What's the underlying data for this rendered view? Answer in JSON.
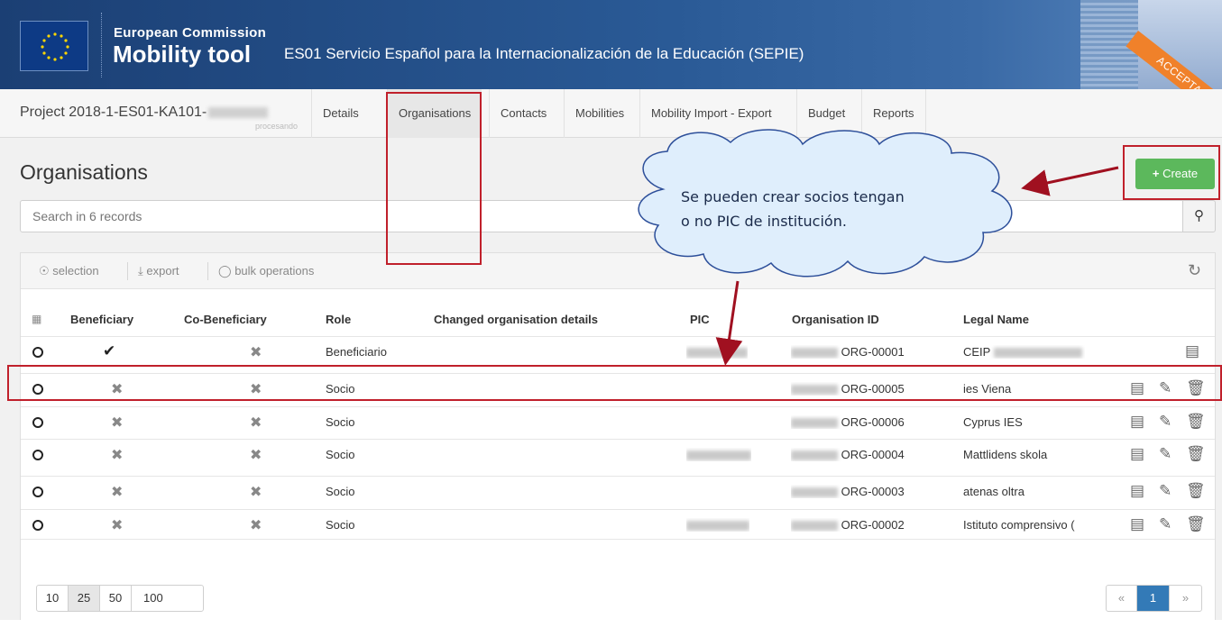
{
  "header": {
    "org_name": "European Commission",
    "app_name": "Mobility tool",
    "agency": "ES01 Servicio Español para la Internacionalización de la Educación (SEPIE)",
    "env_ribbon": "ACCEPTANCE"
  },
  "nav": {
    "project_label": "Project 2018-1-ES01-KA101-",
    "project_sub": "procesando",
    "tabs": [
      "Details",
      "Organisations",
      "Contacts",
      "Mobilities",
      "Mobility Import - Export",
      "Budget",
      "Reports"
    ],
    "active_tab": "Organisations"
  },
  "page": {
    "title": "Organisations",
    "create_label": "Create",
    "search_placeholder": "Search in 6 records"
  },
  "toolbar": {
    "selection_label": "selection",
    "export_label": "export",
    "bulk_label": "bulk operations"
  },
  "table": {
    "columns": [
      "Beneficiary",
      "Co-Beneficiary",
      "Role",
      "Changed organisation details",
      "PIC",
      "Organisation ID",
      "Legal Name"
    ],
    "rows": [
      {
        "beneficiary": true,
        "co_beneficiary": false,
        "role": "Beneficiario",
        "org_id": "ORG-00001",
        "legal_name": "CEIP",
        "has_pic": true
      },
      {
        "beneficiary": false,
        "co_beneficiary": false,
        "role": "Socio",
        "org_id": "ORG-00005",
        "legal_name": "ies Viena",
        "has_pic": false
      },
      {
        "beneficiary": false,
        "co_beneficiary": false,
        "role": "Socio",
        "org_id": "ORG-00006",
        "legal_name": "Cyprus IES",
        "has_pic": false
      },
      {
        "beneficiary": false,
        "co_beneficiary": false,
        "role": "Socio",
        "org_id": "ORG-00004",
        "legal_name": "Mattlidens skola",
        "has_pic": true
      },
      {
        "beneficiary": false,
        "co_beneficiary": false,
        "role": "Socio",
        "org_id": "ORG-00003",
        "legal_name": "atenas oltra",
        "has_pic": false
      },
      {
        "beneficiary": false,
        "co_beneficiary": false,
        "role": "Socio",
        "org_id": "ORG-00002",
        "legal_name": "Istituto comprensivo (",
        "has_pic": true
      }
    ]
  },
  "pager": {
    "sizes": [
      "10",
      "25",
      "50",
      "100"
    ],
    "selected_size": "25",
    "prev": "«",
    "current_page": "1",
    "next": "»"
  },
  "annotation": {
    "line1": "Se pueden crear socios tengan",
    "line2": "o no PIC de institución."
  },
  "colors": {
    "accent_red": "#c0202b",
    "create_green": "#5cb85c",
    "header_blue": "#1b3f74",
    "page_blue": "#337ab7"
  }
}
